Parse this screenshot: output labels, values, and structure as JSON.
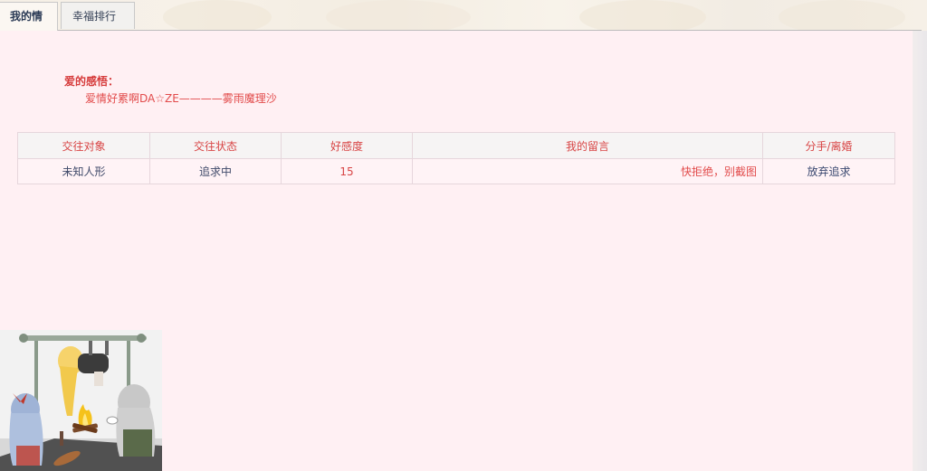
{
  "tabs": [
    {
      "label": "我的情史",
      "active": true
    },
    {
      "label": "幸福排行榜",
      "active": false
    }
  ],
  "feeling": {
    "title": "爱的感悟：",
    "text": "爱情好累啊DA☆ZE————雾雨魔理沙"
  },
  "table": {
    "headers": [
      "交往对象",
      "交往状态",
      "好感度",
      "我的留言",
      "分手/离婚"
    ],
    "rows": [
      {
        "partner": "未知人形",
        "status": "追求中",
        "favor": "15",
        "message": "快拒绝，别截图",
        "action": "放弃追求"
      }
    ]
  },
  "colors": {
    "panel_bg": "#fff0f3",
    "accent_red": "#d84545",
    "text_blue": "#404a6a"
  },
  "illustration": {
    "icon": "touhou-campfire-illustration"
  }
}
